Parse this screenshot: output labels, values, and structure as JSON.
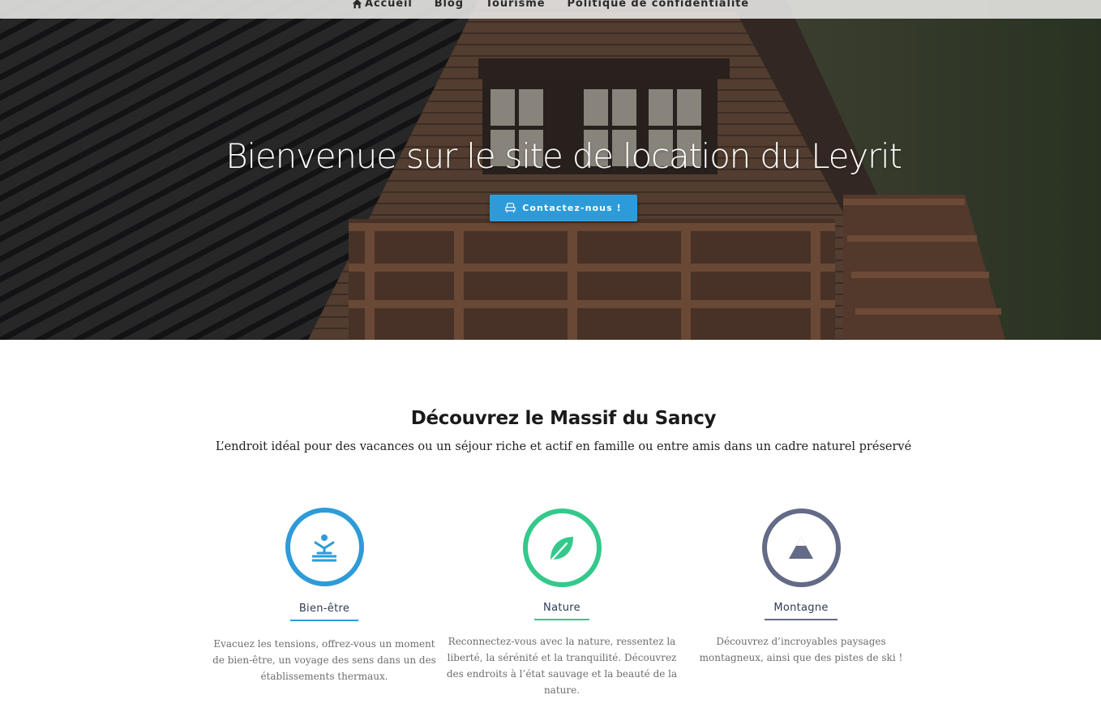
{
  "nav": {
    "items": [
      {
        "label": "Accueil",
        "icon": "home-icon"
      },
      {
        "label": "Blog"
      },
      {
        "label": "Tourisme"
      },
      {
        "label": "Politique de confidentialité"
      }
    ]
  },
  "hero": {
    "title": "Bienvenue sur le site de location du Leyrit",
    "cta_label": "Contactez-nous !",
    "cta_icon": "armchair-icon"
  },
  "intro": {
    "title": "Découvrez le Massif du Sancy",
    "subtitle": "L’endroit idéal pour des vacances ou un séjour riche et actif en famille ou entre amis dans un cadre naturel préservé"
  },
  "features": [
    {
      "label": "Bien-être",
      "icon": "wellness-icon",
      "color": "#2e9bd9",
      "description": "Evacuez les tensions, offrez-vous un moment de bien-être, un voyage des sens dans un des établissements thermaux."
    },
    {
      "label": "Nature",
      "icon": "leaf-icon",
      "color": "#34c98b",
      "description": "Reconnectez-vous avec la nature, ressentez la liberté, la sérénité et la tranquilité. Découvrez des endroits à l’état sauvage et la beauté de la nature."
    },
    {
      "label": "Montagne",
      "icon": "mountain-icon",
      "color": "#636b86",
      "description": "Découvrez d’incroyables paysages montagneux, ainsi que des pistes de ski !"
    }
  ]
}
